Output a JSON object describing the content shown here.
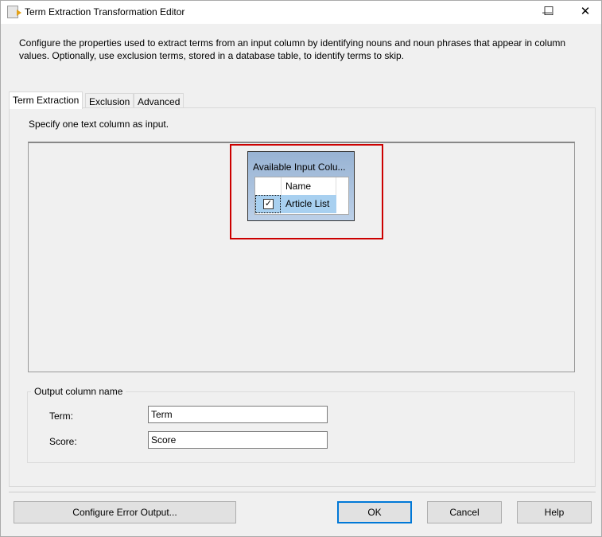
{
  "window": {
    "title": "Term Extraction Transformation Editor",
    "minimize": "—",
    "maximize": "☐",
    "close": "✕"
  },
  "description": "Configure the properties used to extract terms from an input column by identifying nouns and noun phrases that appear in column values. Optionally, use exclusion terms, stored in a database table, to identify terms to skip.",
  "tabs": [
    "Term Extraction",
    "Exclusion",
    "Advanced"
  ],
  "instruction": "Specify one text column as input.",
  "available_columns": {
    "title": "Available Input Colu...",
    "header": "Name",
    "rows": [
      {
        "name": "Article List",
        "checked": true
      }
    ]
  },
  "output": {
    "group_label": "Output column name",
    "term_label": "Term:",
    "term_value": "Term",
    "score_label": "Score:",
    "score_value": "Score"
  },
  "buttons": {
    "configure_error": "Configure Error Output...",
    "ok": "OK",
    "cancel": "Cancel",
    "help": "Help"
  }
}
